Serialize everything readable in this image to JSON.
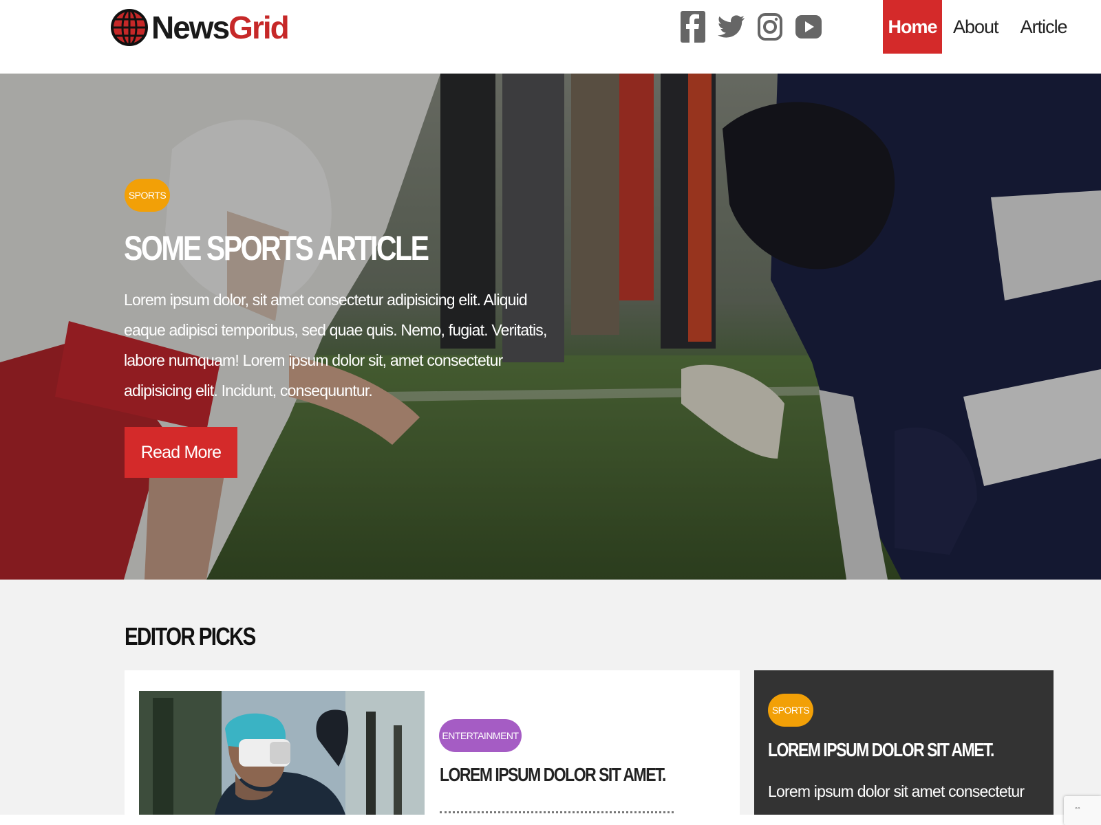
{
  "brand": {
    "logo_part1": "News",
    "logo_part2": "Grid",
    "accent": "#d42a2a"
  },
  "socials": [
    {
      "icon": "facebook-icon"
    },
    {
      "icon": "twitter-icon"
    },
    {
      "icon": "instagram-icon"
    },
    {
      "icon": "youtube-icon"
    }
  ],
  "nav": {
    "home": "Home",
    "about": "About",
    "article": "Article",
    "active": "Home"
  },
  "hero": {
    "badge": "Sports",
    "title": "Some Sports Article",
    "text": "Lorem ipsum dolor, sit amet consectetur adipisicing elit. Aliquid eaque adipisci temporibus, sed quae quis. Nemo, fugiat. Veritatis, labore numquam! Lorem ipsum dolor sit, amet consectetur adipisicing elit. Incidunt, consequuntur.",
    "button": "Read More",
    "badge_color": "#f2a007"
  },
  "editor_picks": {
    "title": "Editor Picks",
    "main_card": {
      "badge": "Entertainment",
      "badge_color": "#a55cc4",
      "title": "Lorem ipsum dolor sit amet."
    },
    "side_card": {
      "badge": "Sports",
      "title": "Lorem ipsum dolor sit amet.",
      "text": "Lorem ipsum dolor sit amet consectetur"
    }
  }
}
